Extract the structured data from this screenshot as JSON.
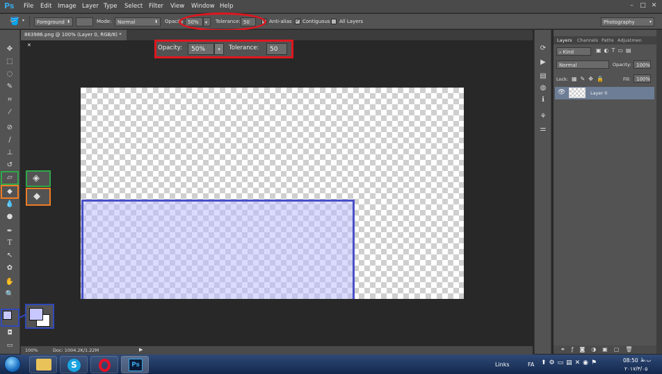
{
  "app": {
    "logo": "Ps",
    "menu": [
      "File",
      "Edit",
      "Image",
      "Layer",
      "Type",
      "Select",
      "Filter",
      "View",
      "Window",
      "Help"
    ],
    "window_controls": [
      "–",
      "□",
      "✕"
    ]
  },
  "options": {
    "fill_source": "Foreground",
    "mode_label": "Mode:",
    "mode_value": "Normal",
    "opacity_label": "Opacity:",
    "opacity_value": "50%",
    "tolerance_label": "Tolerance:",
    "tolerance_value": "50",
    "anti_alias_label": "Anti-alias",
    "contiguous_label": "Contiguous",
    "all_layers_label": "All Layers",
    "workspace": "Photography"
  },
  "document": {
    "tab_title": "863986.png @ 100% (Layer 0, RGB/8) *",
    "zoom": "100%",
    "doc_info": "Doc: 1004.2K/1.22M"
  },
  "callout": {
    "opacity_label": "Opacity:",
    "opacity_value": "50%",
    "tolerance_label": "Tolerance:",
    "tolerance_value": "50"
  },
  "layers_panel": {
    "tabs": [
      "Layers",
      "Channels",
      "Paths",
      "Adjustmen"
    ],
    "kind_filter": "Kind",
    "blend_mode": "Normal",
    "opacity_label": "Opacity:",
    "opacity_value": "100%",
    "lock_label": "Lock:",
    "fill_label": "Fill:",
    "fill_value": "100%",
    "layers": [
      {
        "name": "Layer 0"
      }
    ]
  },
  "taskbar": {
    "links_label": "Links",
    "language": "FA",
    "clock_time": "08:50",
    "clock_ampl": "ب.ظ",
    "clock_date": "۲۰۱۷/۳/۰۵"
  },
  "colors": {
    "highlight_red": "#e0161e",
    "highlight_green": "#2fa84a",
    "highlight_orange": "#f07c24",
    "highlight_blue": "#3048b8",
    "fill_color": "#c8c8ff"
  }
}
